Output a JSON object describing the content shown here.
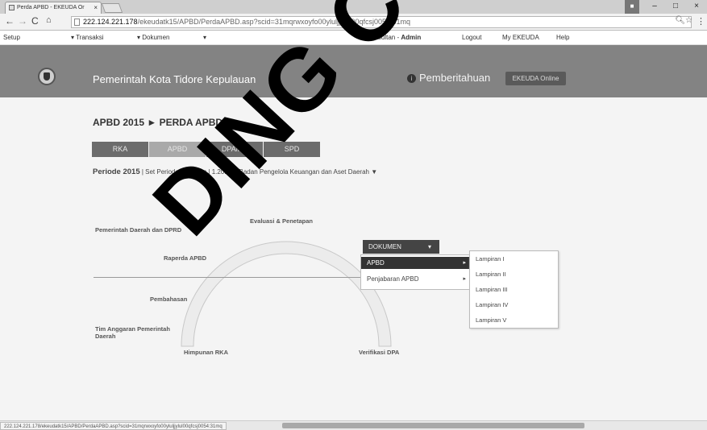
{
  "browser": {
    "tab_title": "Perda APBD - EKEUDA Or",
    "tab_close": "×",
    "url_host": "222.124.221.178",
    "url_path": "/ekeudatk15/APBD/PerdaAPBD.asp?scid=31mqrwxoyfo00yluljjylul00qfcsj0054:31mq",
    "window_controls": [
      "–",
      "□",
      "×"
    ],
    "status_url": "222.124.221.178/ekeudatk15/APBD/PerdaAPBD.asp?scid=31mqrwxoyfo00yluljjylul00qfcsj0054:31mq"
  },
  "menubar": {
    "setup": "Setup",
    "transaksi": "Transaksi",
    "dokumen": "Dokumen",
    "extra_arrow": "▾",
    "user_prefix": "konsultan - ",
    "user_name": "Admin",
    "logout": "Logout",
    "my_ekeuda": "My EKEUDA",
    "help": "Help"
  },
  "header": {
    "title": "Pemerintah Kota Tidore Kepulauan",
    "notification": "Pemberitahuan",
    "online_button": "EKEUDA Online"
  },
  "page": {
    "breadcrumb": "APBD 2015 ► PERDA APBD ►",
    "tabs": [
      {
        "label": "RKA",
        "active": false
      },
      {
        "label": "APBD",
        "active": true
      },
      {
        "label": "DPA/AK",
        "active": false
      },
      {
        "label": "SPD",
        "active": false
      }
    ],
    "period_label": "Periode 2015",
    "period_sep1": " | Set Periode & Entitas | ",
    "period_unit": "1.20.08 - Badan Pengelola Keuangan dan Aset Daerah ▼"
  },
  "diagram": {
    "lane_top": "Pemerintah Daerah dan DPRD",
    "lane_bottom": "Tim Anggaran Pemerintah Daerah",
    "evaluasi": "Evaluasi & Penetapan",
    "raperda": "Raperda APBD",
    "pembahasan": "Pembahasan",
    "himpunan": "Himpunan RKA",
    "verifikasi": "Verifikasi DPA"
  },
  "dropdown": {
    "button": "DOKUMEN",
    "button_caret": "▾",
    "items": [
      "APBD",
      "Penjabaran APBD"
    ],
    "submenu": [
      "Lampiran I",
      "Lampiran II",
      "Lampiran III",
      "Lampiran IV",
      "Lampiran V"
    ]
  },
  "watermark": "DING CO"
}
